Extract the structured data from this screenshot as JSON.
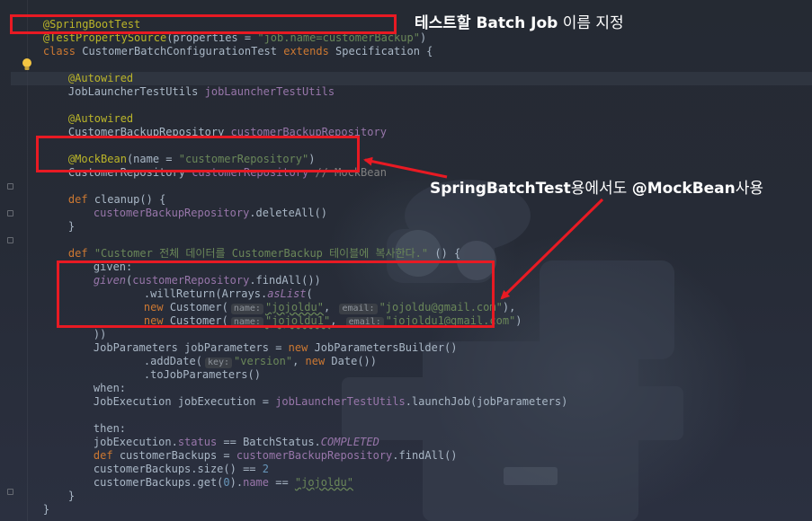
{
  "lines": {
    "l1": {
      "ann": "@SpringBootTest"
    },
    "l2": {
      "ann": "@TestPropertySource",
      "open": "(properties = ",
      "str": "\"job.name=customerBackup\"",
      "close": ")"
    },
    "l3": {
      "kw1": "class",
      "name": " CustomerBatchConfigurationTest ",
      "kw2": "extends",
      "base": " Specification {"
    },
    "l4": {
      "ann": "@Autowired"
    },
    "l5": {
      "type": "JobLauncherTestUtils ",
      "fld": "jobLauncherTestUtils"
    },
    "l6": {
      "ann": "@Autowired"
    },
    "l7": {
      "type": "CustomerBackupRepository ",
      "fld": "customerBackupRepository"
    },
    "l8": {
      "ann": "@MockBean",
      "open": "(name = ",
      "str": "\"customerRepository\"",
      "close": ")"
    },
    "l9": {
      "type": "CustomerRepository ",
      "fld": "customerRepository",
      "cmt": " // MockBean"
    },
    "l10": {
      "kw": "def",
      "rest": " cleanup() {"
    },
    "l11": {
      "fld": "customerBackupRepository",
      "rest": ".deleteAll()"
    },
    "l12": {
      "text": "}"
    },
    "l13": {
      "kw": "def",
      "str": " \"Customer 전체 데이터를 CustomerBackup 테이블에 복사한다.\"",
      "rest": " () {"
    },
    "l14": {
      "text": "given:"
    },
    "l15": {
      "fn": "given",
      "open": "(",
      "fld": "customerRepository",
      "rest": ".findAll())"
    },
    "l16": {
      "a": ".willReturn(Arrays.",
      "fn": "asList",
      "b": "("
    },
    "l17": {
      "kw": "new",
      "cls": " Customer(",
      "hint1": "name:",
      "s1": "\"jojoldu\"",
      "sep": ", ",
      "hint2": "email:",
      "s2": "\"jojoldu@gmail.com\"",
      "end": "),"
    },
    "l18": {
      "kw": "new",
      "cls": " Customer(",
      "hint1": "name:",
      "s1": "\"jojoldu1\"",
      "sep": ", ",
      "hint2": "email:",
      "s2": "\"jojoldu1@gmail.com\"",
      "end": ")"
    },
    "l19": {
      "text": "))"
    },
    "l20": {
      "a": "JobParameters jobParameters = ",
      "kw": "new",
      "b": " JobParametersBuilder()"
    },
    "l21": {
      "a": ".addDate(",
      "hint": "key:",
      "str": "\"version\"",
      "sep": ", ",
      "kw": "new",
      "b": " Date())"
    },
    "l22": {
      "text": ".toJobParameters()"
    },
    "l23": {
      "text": "when:"
    },
    "l24": {
      "a": "JobExecution jobExecution = ",
      "fld": "jobLauncherTestUtils",
      "b": ".launchJob(jobParameters)"
    },
    "l25": {
      "text": "then:"
    },
    "l26": {
      "a": "jobExecution.",
      "fld": "status",
      "b": " == BatchStatus.",
      "c": "COMPLETED"
    },
    "l27": {
      "kw": "def",
      "a": " customerBackups = ",
      "fld": "customerBackupRepository",
      "b": ".findAll()"
    },
    "l28": {
      "a": "customerBackups.size() == ",
      "num": "2"
    },
    "l29": {
      "a": "customerBackups.get(",
      "num": "0",
      "b": ").",
      "fld": "name",
      "c": " == ",
      "str": "\"jojoldu\""
    },
    "l30": {
      "text": "}"
    },
    "l31": {
      "text": "}"
    }
  },
  "annotations": {
    "label1_bold": "테스트할 Batch Job",
    "label1_rest": " 이름 지정",
    "label2_bold": "SpringBatchTest",
    "label2_mid": "용에서도 ",
    "label2_bold2": "@MockBean",
    "label2_end": "사용"
  },
  "colors": {
    "annotation": "#bbb529",
    "keyword": "#cc7832",
    "string": "#6a8759",
    "field": "#9876aa",
    "highlight_box": "#e81a23"
  },
  "icons": {
    "bulb": "lightbulb-icon",
    "fold": "fold-marker-icon"
  }
}
